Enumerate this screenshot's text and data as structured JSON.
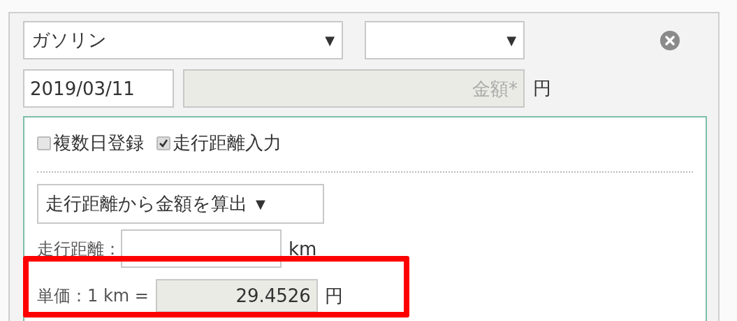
{
  "category_select": {
    "value": "ガソリン",
    "caret": "▼"
  },
  "sub_select": {
    "caret": "▼"
  },
  "date_field": {
    "value": "2019/03/11"
  },
  "amount_field": {
    "placeholder": "金額*",
    "disabled": true
  },
  "amount_unit": "円",
  "options": [
    {
      "label": "複数日登録",
      "checked": false
    },
    {
      "label": "走行距離入力",
      "checked": true
    }
  ],
  "mode_select": {
    "value": "走行距離から金額を算出",
    "caret": "▼"
  },
  "distance": {
    "label": "走行距離：",
    "unit": "km"
  },
  "unit_price": {
    "label": "単価：1 km =",
    "value": "29.4526",
    "unit": "円",
    "highlighted": true
  }
}
